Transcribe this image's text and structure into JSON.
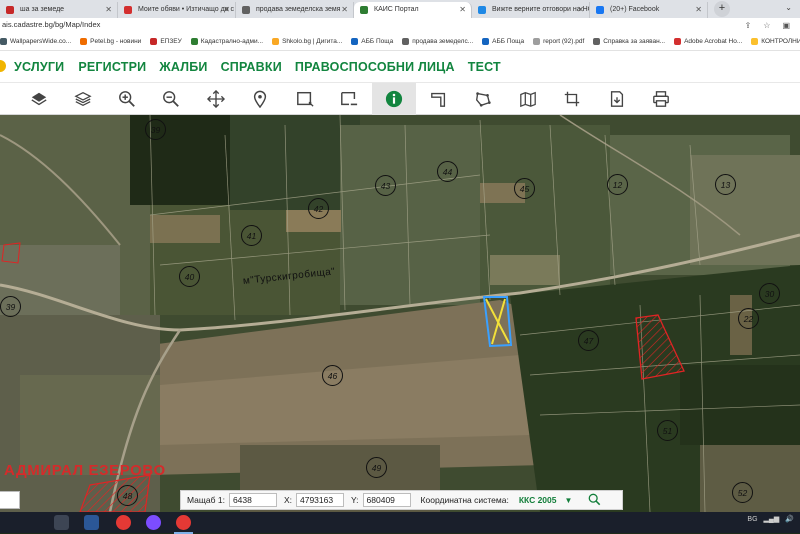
{
  "browser": {
    "tabs": [
      {
        "title": "ша за земеде",
        "fav_color": "#c62828",
        "active": false
      },
      {
        "title": "Моите обяви • Изтичащо до с",
        "fav_color": "#d32f2f",
        "active": false
      },
      {
        "title": "продава земеделска земя",
        "fav_color": "#616161",
        "active": false
      },
      {
        "title": "КАИС Портал",
        "fav_color": "#2e7d32",
        "active": true
      },
      {
        "title": "Вижте верните отговори на НО",
        "fav_color": "#1e88e5",
        "active": false
      },
      {
        "title": "(20+) Facebook",
        "fav_color": "#1877f2",
        "active": false
      }
    ],
    "new_tab": "+",
    "url": "ais.cadastre.bg/bg/Map/Index",
    "bookmarks": [
      {
        "label": "WallpapersWide.co...",
        "color": "#455a64"
      },
      {
        "label": "Petel.bg - новини",
        "color": "#ef6c00"
      },
      {
        "label": "ЕПЗЕУ",
        "color": "#c62828"
      },
      {
        "label": "Кадастрално-адми...",
        "color": "#2e7d32"
      },
      {
        "label": "Shkolo.bg | Дигита...",
        "color": "#f9a825"
      },
      {
        "label": "АББ Поща",
        "color": "#1565c0"
      },
      {
        "label": "продава земеделс...",
        "color": "#616161"
      },
      {
        "label": "АББ Поща",
        "color": "#1565c0"
      },
      {
        "label": "report (92).pdf",
        "color": "#9e9e9e"
      },
      {
        "label": "Справка за заяван...",
        "color": "#616161"
      },
      {
        "label": "Adobe Acrobat Ho...",
        "color": "#d32f2f"
      },
      {
        "label": "КОНТРОЛНИ И ТЕ...",
        "color": "#fbc02d"
      }
    ]
  },
  "site_nav": {
    "items": [
      "УСЛУГИ",
      "РЕГИСТРИ",
      "ЖАЛБИ",
      "СПРАВКИ",
      "ПРАВОСПОСОБНИ ЛИЦА",
      "ТЕСТ"
    ]
  },
  "map_tools": [
    {
      "name": "layers-icon",
      "active": false
    },
    {
      "name": "layers-outline-icon",
      "active": false
    },
    {
      "name": "zoom-in-icon",
      "active": false
    },
    {
      "name": "zoom-out-icon",
      "active": false
    },
    {
      "name": "pan-arrows-icon",
      "active": false
    },
    {
      "name": "location-pin-icon",
      "active": false
    },
    {
      "name": "select-rectangle-icon",
      "active": false
    },
    {
      "name": "deselect-rectangle-icon",
      "active": false
    },
    {
      "name": "info-icon",
      "active": true
    },
    {
      "name": "measure-icon",
      "active": false
    },
    {
      "name": "polygon-draw-icon",
      "active": false
    },
    {
      "name": "map-icon",
      "active": false
    },
    {
      "name": "crosshair-icon",
      "active": false
    },
    {
      "name": "export-document-icon",
      "active": false
    },
    {
      "name": "print-icon",
      "active": false
    }
  ],
  "map": {
    "locality_label": "м\"Турскигробища\"",
    "area_name": "АДМИРАЛ ЕЗЕРОВО",
    "plots": [
      {
        "n": "39"
      },
      {
        "n": "43"
      },
      {
        "n": "44"
      },
      {
        "n": "45"
      },
      {
        "n": "12"
      },
      {
        "n": "13"
      },
      {
        "n": "42"
      },
      {
        "n": "41"
      },
      {
        "n": "40"
      },
      {
        "n": "30"
      },
      {
        "n": "22"
      },
      {
        "n": "47"
      },
      {
        "n": "46"
      },
      {
        "n": "51"
      },
      {
        "n": "49"
      },
      {
        "n": "48"
      },
      {
        "n": "52"
      },
      {
        "n": "39"
      }
    ]
  },
  "status": {
    "scale_label": "Мащаб 1:",
    "scale_value": "6438",
    "x_label": "X:",
    "x_value": "4793163",
    "y_label": "Y:",
    "y_value": "680409",
    "system_label": "Координатна система:",
    "system_value": "ККС 2005"
  },
  "tray": {
    "lang": "BG"
  }
}
